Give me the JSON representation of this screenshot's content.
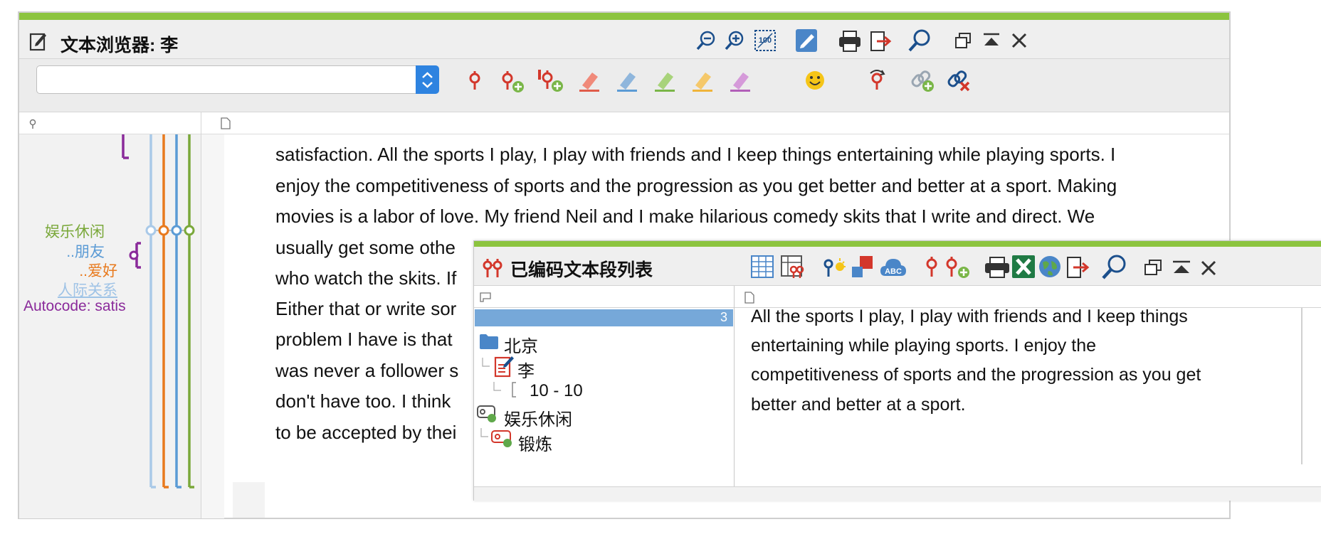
{
  "main_window": {
    "title": "文本浏览器: 李",
    "combo_value": "",
    "text_lines": [
      "satisfaction. All the sports I play, I play with friends and I keep things entertaining while playing sports. I",
      "enjoy the competitiveness of sports and the progression as you get better and better at a sport. Making",
      "movies is a labor of love. My friend Neil and I make hilarious comedy skits that I write and direct. We",
      "usually get some othe",
      "who watch the skits. If",
      "Either that or write sor",
      "problem I have is that",
      "was never a follower s",
      "don't have too. I think",
      "to be accepted by thei"
    ],
    "code_labels": [
      {
        "text": "娱乐休闲",
        "color": "#7aa83a"
      },
      {
        "text": "..朋友",
        "color": "#5b9bd5"
      },
      {
        "text": "..爱好",
        "color": "#e87a1e"
      },
      {
        "text": "人际关系",
        "color": "#9fc3e6"
      },
      {
        "text": "Autocode: satis",
        "color": "#8a2a9a"
      }
    ],
    "code_bar_colors": [
      "#a9c9e8",
      "#e87a1e",
      "#5b9bd5",
      "#7aa83a"
    ],
    "toolbar_icons": [
      "code-icon",
      "code-new-icon",
      "code-in-vivo-icon",
      "highlight-red-icon",
      "highlight-blue-icon",
      "highlight-green-icon",
      "highlight-yellow-icon",
      "highlight-purple-icon",
      "emoticon-icon",
      "undo-code-icon",
      "link-add-icon",
      "link-remove-icon"
    ],
    "title_icons": [
      "zoom-out-icon",
      "zoom-in-icon",
      "zoom-100-icon",
      "edit-mode-icon",
      "print-icon",
      "export-icon",
      "search-icon",
      "restore-window-icon",
      "minimize-window-icon",
      "close-icon"
    ]
  },
  "popup": {
    "title": "已编码文本段列表",
    "count": "3",
    "tree": {
      "group": "北京",
      "document": "李",
      "position": "10 - 10",
      "code_parent": "娱乐休闲",
      "code_child": "锻炼"
    },
    "segment_lines": [
      "All the sports I play, I play with friends and I keep things",
      "entertaining while playing sports. I enjoy the",
      "competitiveness of sports and the progression as you get",
      "better and better at a sport."
    ],
    "toolbar_icons": [
      "table-view-icon",
      "code-matrix-icon",
      "smart-code-icon",
      "color-code-icon",
      "word-cloud-icon",
      "code-icon",
      "code-new-icon",
      "print-icon",
      "excel-export-icon",
      "web-export-icon",
      "export-icon",
      "search-icon",
      "restore-window-icon",
      "minimize-window-icon",
      "close-icon"
    ],
    "accent_color": "#8cc43f"
  }
}
